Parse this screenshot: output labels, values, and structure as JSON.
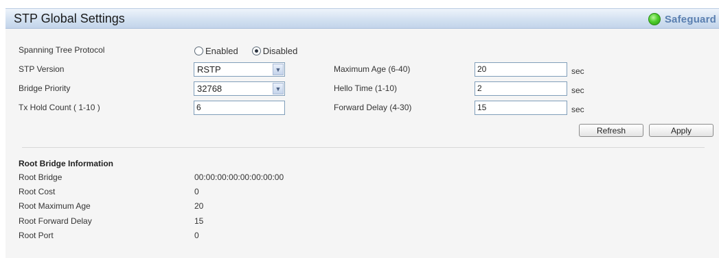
{
  "header": {
    "title": "STP Global Settings",
    "safeguard_label": "Safeguard",
    "safeguard_color": "#4fce2d"
  },
  "settings": {
    "spanning_tree_protocol": {
      "label": "Spanning Tree Protocol",
      "options": [
        "Enabled",
        "Disabled"
      ],
      "selected": "Disabled"
    },
    "stp_version": {
      "label": "STP Version",
      "value": "RSTP"
    },
    "bridge_priority": {
      "label": "Bridge Priority",
      "value": "32768"
    },
    "tx_hold_count": {
      "label": "Tx Hold Count ( 1-10 )",
      "value": "6"
    },
    "maximum_age": {
      "label": "Maximum Age (6-40)",
      "value": "20",
      "unit": "sec"
    },
    "hello_time": {
      "label": "Hello Time (1-10)",
      "value": "2",
      "unit": "sec"
    },
    "forward_delay": {
      "label": "Forward Delay (4-30)",
      "value": "15",
      "unit": "sec"
    }
  },
  "buttons": {
    "refresh": "Refresh",
    "apply": "Apply"
  },
  "root_bridge": {
    "section_title": "Root Bridge Information",
    "rows": [
      {
        "label": "Root Bridge",
        "value": "00:00:00:00:00:00:00:00"
      },
      {
        "label": "Root Cost",
        "value": "0"
      },
      {
        "label": "Root Maximum Age",
        "value": "20"
      },
      {
        "label": "Root Forward Delay",
        "value": "15"
      },
      {
        "label": "Root Port",
        "value": "0"
      }
    ]
  }
}
